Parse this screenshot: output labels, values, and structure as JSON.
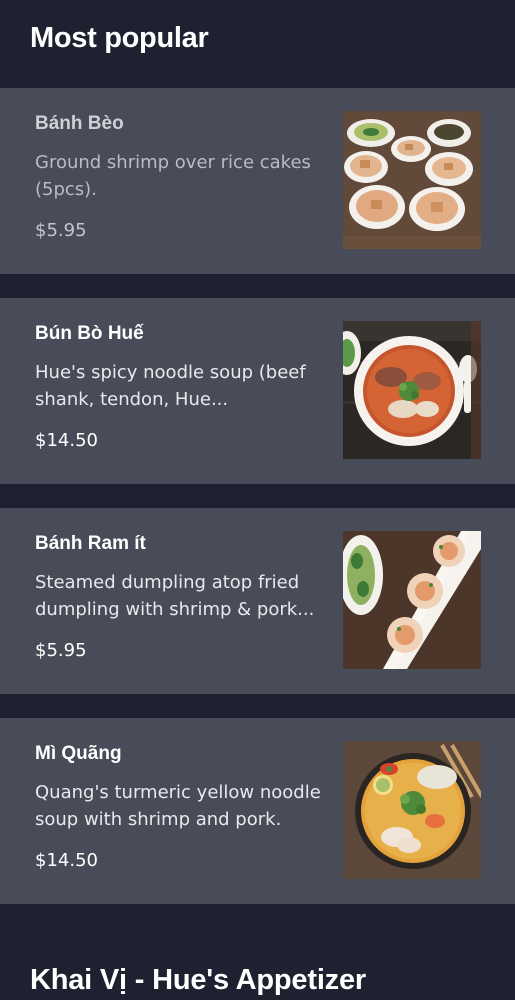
{
  "sections": [
    {
      "title": "Most popular",
      "items": [
        {
          "name": "Bánh Bèo",
          "description": "Ground shrimp over rice cakes (5pcs).",
          "price": "$5.95",
          "photo_icon": "rice-cakes-photo"
        },
        {
          "name": "Bún Bò Huế",
          "description": "Hue's spicy noodle soup (beef shank, tendon, Hue...",
          "price": "$14.50",
          "photo_icon": "noodle-soup-photo"
        },
        {
          "name": "Bánh Ram ít",
          "description": "Steamed dumpling atop fried dumpling with shrimp & pork...",
          "price": "$5.95",
          "photo_icon": "dumplings-photo"
        },
        {
          "name": "Mì Quãng",
          "description": "Quang's turmeric yellow noodle soup with shrimp and pork.",
          "price": "$14.50",
          "photo_icon": "turmeric-noodle-photo"
        }
      ]
    },
    {
      "title": "Khai Vị - Hue's Appetizer"
    }
  ],
  "colors": {
    "background": "#1d2130",
    "card": "#474c58",
    "text_primary": "#ffffff",
    "text_muted": "#b9bcc3"
  }
}
